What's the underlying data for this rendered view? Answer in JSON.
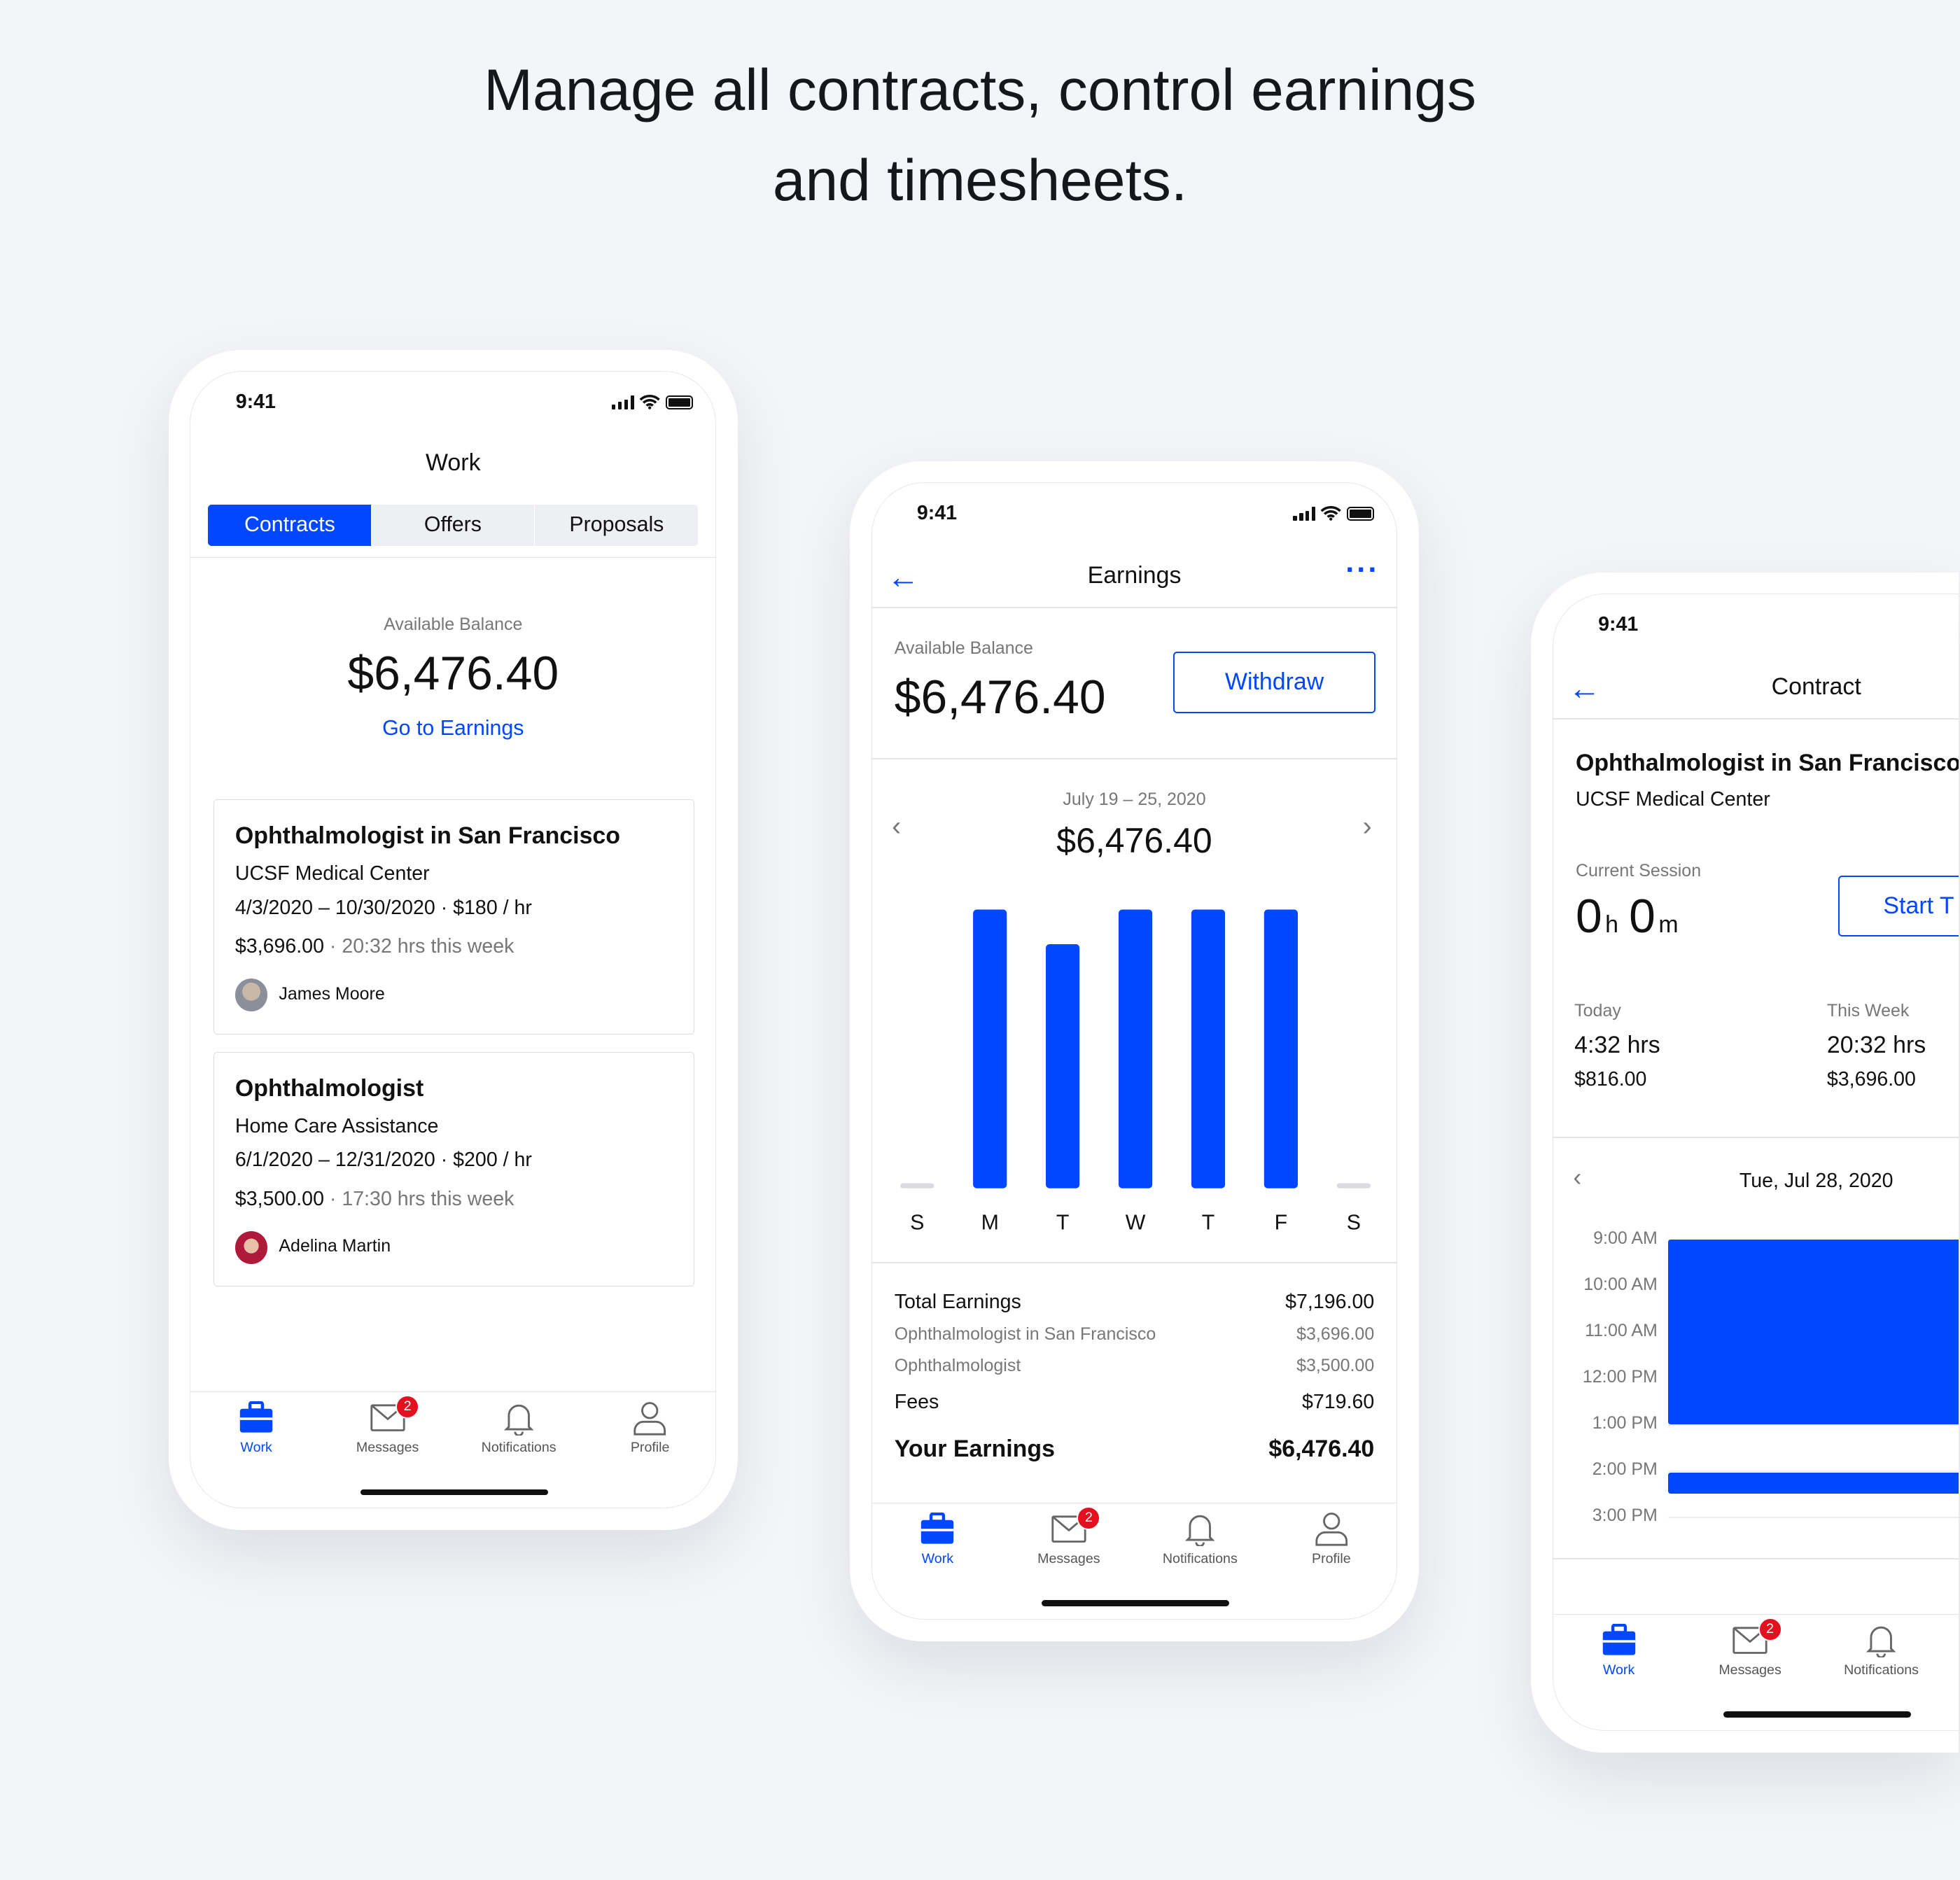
{
  "headline": {
    "line1": "Manage all contracts, control earnings",
    "line2": "and timesheets."
  },
  "status_time": "9:41",
  "colors": {
    "accent": "#0047ff",
    "badge": "#e3101f",
    "background": "#f4f5f8"
  },
  "nav": {
    "items": [
      {
        "label": "Work",
        "icon": "briefcase-icon",
        "active": true
      },
      {
        "label": "Messages",
        "icon": "envelope-icon",
        "badge": "2"
      },
      {
        "label": "Notifications",
        "icon": "bell-icon"
      },
      {
        "label": "Profile",
        "icon": "person-icon"
      }
    ]
  },
  "work": {
    "title": "Work",
    "tabs": [
      {
        "label": "Contracts",
        "active": true
      },
      {
        "label": "Offers"
      },
      {
        "label": "Proposals"
      }
    ],
    "balance_label": "Available Balance",
    "balance": "$6,476.40",
    "earnings_link": "Go to Earnings",
    "contracts": [
      {
        "title": "Ophthalmologist in San Francisco",
        "company": "UCSF Medical Center",
        "terms": "4/3/2020 – 10/30/2020 · $180 / hr",
        "amount": "$3,696.00",
        "hours": " · 20:32 hrs this week",
        "client": "James Moore"
      },
      {
        "title": "Ophthalmologist",
        "company": "Home Care Assistance",
        "terms": "6/1/2020 – 12/31/2020 · $200 / hr",
        "amount": "$3,500.00",
        "hours": " · 17:30 hrs this week",
        "client": "Adelina Martin"
      }
    ]
  },
  "earnings": {
    "title": "Earnings",
    "balance_label": "Available Balance",
    "balance": "$6,476.40",
    "withdraw": "Withdraw",
    "range": "July 19 – 25, 2020",
    "range_total": "$6,476.40",
    "summary": [
      {
        "label": "Total Earnings",
        "value": "$7,196.00",
        "kind": "main"
      },
      {
        "label": "Ophthalmologist in San Francisco",
        "value": "$3,696.00",
        "kind": "sub"
      },
      {
        "label": "Ophthalmologist",
        "value": "$3,500.00",
        "kind": "sub"
      },
      {
        "label": "Fees",
        "value": "$719.60",
        "kind": "main"
      },
      {
        "label": "Your Earnings",
        "value": "$6,476.40",
        "kind": "total"
      }
    ]
  },
  "chart_data": {
    "type": "bar",
    "categories": [
      "S",
      "M",
      "T",
      "W",
      "T",
      "F",
      "S"
    ],
    "values": [
      0,
      1480,
      1296,
      1480,
      1480,
      1480,
      0
    ],
    "ylim": [
      0,
      1480
    ],
    "grid": false,
    "color": "#0047ff"
  },
  "contract": {
    "title": "Contract",
    "job": "Ophthalmologist in San Francisco",
    "company": "UCSF Medical Center",
    "session_label": "Current Session",
    "session_h": "0",
    "h_unit": "h",
    "session_m": "0",
    "m_unit": "m",
    "start": "Start T",
    "today_label": "Today",
    "today_hrs": "4:32 hrs",
    "today_amt": "$816.00",
    "week_label": "This Week",
    "week_hrs": "20:32 hrs",
    "week_amt": "$3,696.00",
    "date": "Tue, Jul 28, 2020",
    "hours": [
      "9:00 AM",
      "10:00 AM",
      "11:00 AM",
      "12:00 PM",
      "1:00 PM",
      "2:00 PM",
      "3:00 PM"
    ],
    "blocks": [
      {
        "start": 9,
        "end": 13
      },
      {
        "start": 14.05,
        "end": 14.5
      }
    ]
  }
}
